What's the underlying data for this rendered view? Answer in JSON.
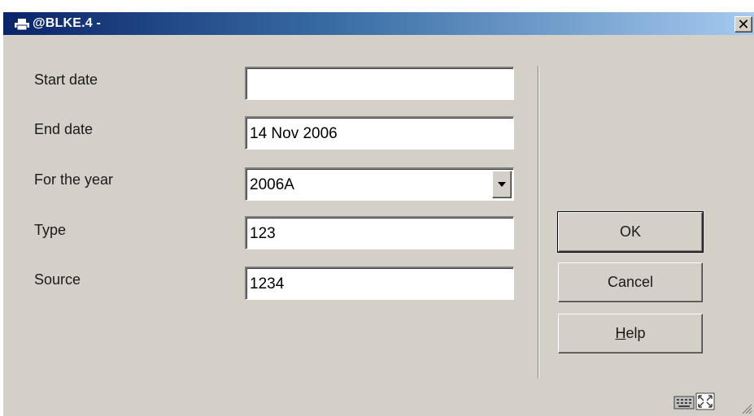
{
  "window": {
    "title": "@BLKE.4 -"
  },
  "form": {
    "fields": [
      {
        "label": "Start date",
        "value": ""
      },
      {
        "label": "End date",
        "value": "14 Nov 2006"
      },
      {
        "label": "For the year",
        "value": "2006A"
      },
      {
        "label": "Type",
        "value": "123"
      },
      {
        "label": "Source",
        "value": "1234"
      }
    ]
  },
  "buttons": {
    "ok": "OK",
    "cancel": "Cancel",
    "help_mnemonic": "H",
    "help_rest": "elp"
  },
  "icons": {
    "title": "printer-icon",
    "close": "close-icon",
    "status": [
      "keyboard-icon",
      "fullscreen-icon"
    ],
    "resize": "resize-grip-icon"
  }
}
